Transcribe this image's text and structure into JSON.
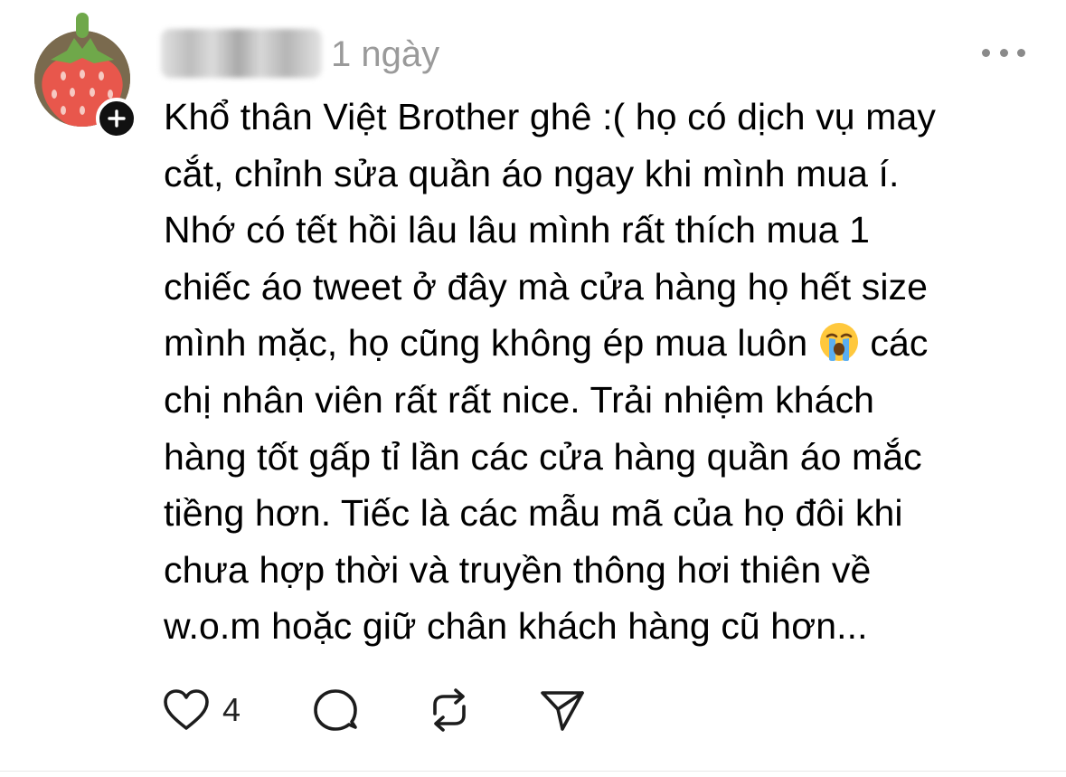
{
  "post": {
    "timestamp": "1 ngày",
    "lines": [
      "Khổ thân Việt Brother ghê :( họ có dịch vụ may",
      "cắt, chỉnh sửa quần áo ngay khi mình mua í.",
      "Nhớ có tết hồi lâu lâu mình rất thích mua 1",
      "chiếc áo tweet ở đây mà cửa hàng họ hết size",
      "tiềng hơn. Tiếc là các mẫu mã của họ đôi khi",
      "chưa hợp thời và truyền thông hơi thiên về",
      "w.o.m hoặc giữ chân khách hàng cũ hơn..."
    ],
    "line5_before_emoji": "mình mặc, họ cũng không ép mua luôn",
    "line5_after_emoji": "các",
    "line6": "chị nhân viên rất rất nice. Trải nhiệm khách",
    "line7": "hàng tốt gấp tỉ lần các cửa hàng quần áo mắc",
    "emoji_name": "loudly-crying-face",
    "like_count": "4"
  },
  "icons": {
    "avatar": "strawberry",
    "follow": "plus-icon",
    "more": "more-options-icon",
    "like": "heart-icon",
    "reply": "comment-icon",
    "repost": "repost-icon",
    "share": "send-icon"
  },
  "colors": {
    "text": "#000000",
    "muted": "#9a9a9a",
    "icon": "#1c1c1c",
    "strawberry": "#e8574c",
    "leaf": "#6fa84a"
  }
}
